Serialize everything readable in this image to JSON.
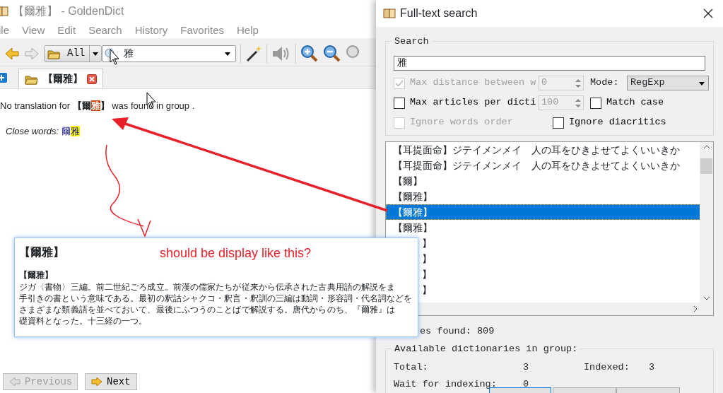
{
  "main_window": {
    "title": "【爾雅】 - GoldenDict",
    "menu": [
      "ile",
      "View",
      "Edit",
      "Search",
      "History",
      "Favorites",
      "Help"
    ],
    "toolbar": {
      "group": "All",
      "search": "雅"
    },
    "tabs": [
      {
        "label": "【爾雅】",
        "selected": true
      }
    ],
    "article": {
      "message": {
        "before": "No translation for",
        "word": "【爾",
        "word_highlight": "雅",
        "word_end": "】",
        "after": "was found in group ."
      },
      "close_words": {
        "label": "Close words:",
        "word": "爾",
        "word_highlight": "雅"
      }
    },
    "nav_buttons": [
      {
        "label": "Previous",
        "disabled": true
      },
      {
        "label": "Next",
        "disabled": false
      }
    ]
  },
  "popup": {
    "heading": "【爾雅】",
    "annotation": "should be display like this?",
    "headword": "【爾雅】",
    "lines": [
      "ジガ〈書物〉三編。前二世紀ごろ成立。前漢の儒家たちが従来から伝承された古典用語の解説をま",
      "手引きの書という意味である。最初の釈詁シャクコ・釈言・釈訓の三編は動詞・形容詞・代名詞などを",
      "さまざまな類義語を並べておいて、最後にふつうのことばで解説する。唐代からのち、『爾雅』は",
      "礎資料となった。十三経の一つ。"
    ]
  },
  "dialog": {
    "title": "Full-text search",
    "search_group": "Search",
    "search_value": "雅",
    "options": [
      [
        {
          "kind": "check",
          "label": "Max distance between w",
          "checked": true,
          "disabled": true
        },
        {
          "kind": "spin",
          "value": "0",
          "disabled": true
        },
        {
          "kind": "select",
          "label": "Mode:",
          "value": "RegExp"
        }
      ],
      [
        {
          "kind": "check",
          "label": "Max articles per dicti",
          "checked": false,
          "disabled": false
        },
        {
          "kind": "spin",
          "value": "100",
          "disabled": true
        },
        {
          "kind": "check",
          "label": "Match case",
          "checked": false,
          "disabled": false
        }
      ],
      [
        {
          "kind": "check",
          "label": "Ignore words order",
          "checked": false,
          "disabled": true
        },
        {
          "kind": "check",
          "label": "Ignore diacritics",
          "checked": false,
          "disabled": false
        }
      ]
    ],
    "results": [
      {
        "text": "【耳提面命】ジテイメンメイ　人の耳をひきよせてよくいいきか",
        "selected": false,
        "clipped": false
      },
      {
        "text": "【耳提面命】ジテイメンメイ　人の耳をひきよせてよくいいきか",
        "selected": false,
        "clipped": false
      },
      {
        "text": "【爾】",
        "selected": false,
        "clipped": false
      },
      {
        "text": "【爾雅】",
        "selected": false,
        "clipped": false
      },
      {
        "text": "【爾雅】",
        "selected": true,
        "clipped": false
      },
      {
        "text": "【爾雅】",
        "selected": false,
        "clipped": false
      },
      {
        "text": "】",
        "selected": false,
        "clipped": true
      },
      {
        "text": "】",
        "selected": false,
        "clipped": true
      },
      {
        "text": "】",
        "selected": false,
        "clipped": true
      },
      {
        "text": "】",
        "selected": false,
        "clipped": true
      }
    ],
    "articles_found": "es found: 809",
    "dict_group": "Available dictionaries in group:",
    "stats": [
      {
        "label": "Total:",
        "value": "3"
      },
      {
        "label": "Indexed:",
        "value": "3"
      },
      {
        "label": "Wait for indexing:",
        "value": "0"
      }
    ]
  }
}
